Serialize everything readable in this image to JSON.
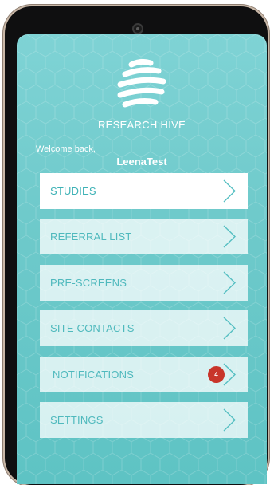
{
  "app": {
    "brand": "RESEARCH HIVE",
    "welcome_text": "Welcome back,",
    "username": "LeenaTest"
  },
  "menu": {
    "items": [
      {
        "label": "STUDIES",
        "icon": "chevron-right-icon",
        "active": true
      },
      {
        "label": "REFERRAL LIST",
        "icon": "chevron-right-icon"
      },
      {
        "label": "PRE-SCREENS",
        "icon": "chevron-right-icon"
      },
      {
        "label": "SITE CONTACTS",
        "icon": "chevron-right-icon"
      },
      {
        "label": "NOTIFICATIONS",
        "icon": "chevron-right-icon",
        "badge": "4"
      },
      {
        "label": "SETTINGS",
        "icon": "chevron-right-icon"
      }
    ]
  },
  "colors": {
    "accent": "#4fb9bd",
    "screen_bg": "#6fcacb",
    "badge": "#c8352a"
  }
}
